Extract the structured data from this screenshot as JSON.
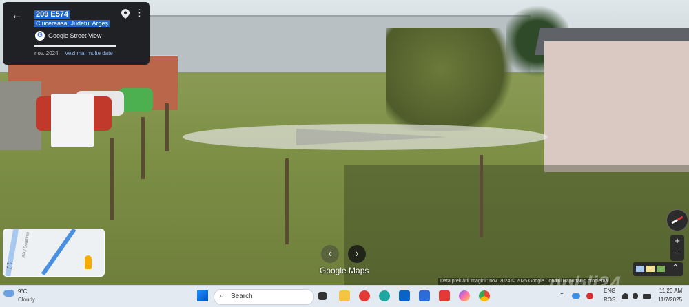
{
  "info_card": {
    "title": "209 E574",
    "subtitle": "Clucereasa, Județul Argeș",
    "source_label": "Google Street View",
    "capture_date": "nov. 2024",
    "more_dates_link": "Vezi mai multe date"
  },
  "minimap": {
    "road_label": "Râul Doamnei"
  },
  "navigation": {
    "brand": "Google Maps"
  },
  "zoom": {
    "in": "+",
    "out": "−"
  },
  "attribution": "Data preluării imaginii: nov. 2024   © 2025 Google   Condiții   Raportați o problemă",
  "watermark": "publi24",
  "taskbar": {
    "weather_temp": "9°C",
    "weather_condition": "Cloudy",
    "search_placeholder": "Search",
    "language_top": "ENG",
    "language_bottom": "ROS",
    "time": "11:20 AM",
    "date": "11/7/2025"
  },
  "icons": {
    "back": "←",
    "more": "⋮",
    "nav_left": "‹",
    "nav_right": "›",
    "expand": "⛶",
    "search": "⌕"
  },
  "colors": {
    "card_bg": "#202124",
    "highlight": "#1967d2",
    "link": "#8ab4f8",
    "taskbar_bg": "#e4eaf2"
  }
}
